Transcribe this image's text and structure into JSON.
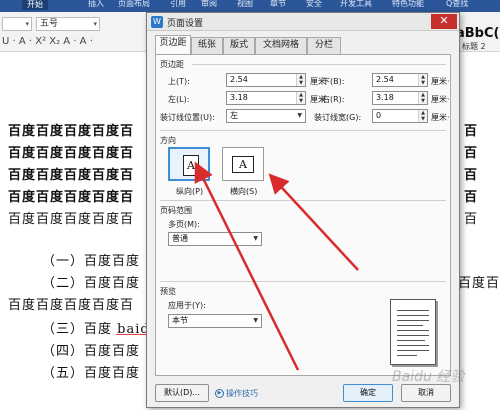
{
  "app": {
    "menu": [
      "开始",
      "插入",
      "页面布局",
      "引用",
      "审阅",
      "视图",
      "章节",
      "安全",
      "开发工具",
      "特色功能",
      "Q查找"
    ],
    "active_menu": "开始",
    "font_name": "",
    "font_size": "五号",
    "toolbar_glyphs": "U · A · X² X₂ A · A ·",
    "style_preview": "aBbC(",
    "style_sub": "标题 2"
  },
  "document": {
    "bold_lines": [
      "百度百度百度百度百",
      "百度百度百度百度百",
      "百度百度百度百度百",
      "百度百度百度百度百"
    ],
    "plain_line": "百度百度百度百度百",
    "list_items": [
      "（一）百度百度",
      "（二）百度百度",
      "（三）百度 baidu",
      "（四）百度百度",
      "（五）百度百度"
    ],
    "mid_line": "百度百度百度百度百",
    "right_fragments": [
      "百",
      "百",
      "百",
      "百",
      "百",
      "百度百"
    ]
  },
  "dialog": {
    "title": "页面设置",
    "close_glyph": "✕",
    "tabs": [
      "页边距",
      "纸张",
      "版式",
      "文档网格",
      "分栏"
    ],
    "active_tab": "页边距",
    "margins": {
      "group_label": "页边距",
      "top_label": "上(T):",
      "top_value": "2.54",
      "top_unit": "厘米·",
      "bottom_label": "下(B):",
      "bottom_value": "2.54",
      "bottom_unit": "厘米·",
      "left_label": "左(L):",
      "left_value": "3.18",
      "left_unit": "厘米·",
      "right_label": "右(R):",
      "right_value": "3.18",
      "right_unit": "厘米·",
      "gutter_pos_label": "装订线位置(U):",
      "gutter_pos_value": "左",
      "gutter_width_label": "装订线宽(G):",
      "gutter_width_value": "0",
      "gutter_width_unit": "厘米·"
    },
    "orientation": {
      "group_label": "方向",
      "portrait_label": "纵向(P)",
      "landscape_label": "横向(S)",
      "selected": "portrait",
      "glyph": "A"
    },
    "pages": {
      "group_label": "页码范围",
      "multi_label": "多页(M):",
      "multi_value": "普通"
    },
    "preview": {
      "group_label": "预览",
      "apply_label": "应用于(Y):",
      "apply_value": "本节"
    },
    "buttons": {
      "default": "默认(D)...",
      "tips": "操作技巧",
      "ok": "确定",
      "cancel": "取消"
    }
  },
  "annotations": {
    "arrow_color": "#d92b2b",
    "accent": "#3c8fd6",
    "watermark": "Baidu 经验"
  }
}
